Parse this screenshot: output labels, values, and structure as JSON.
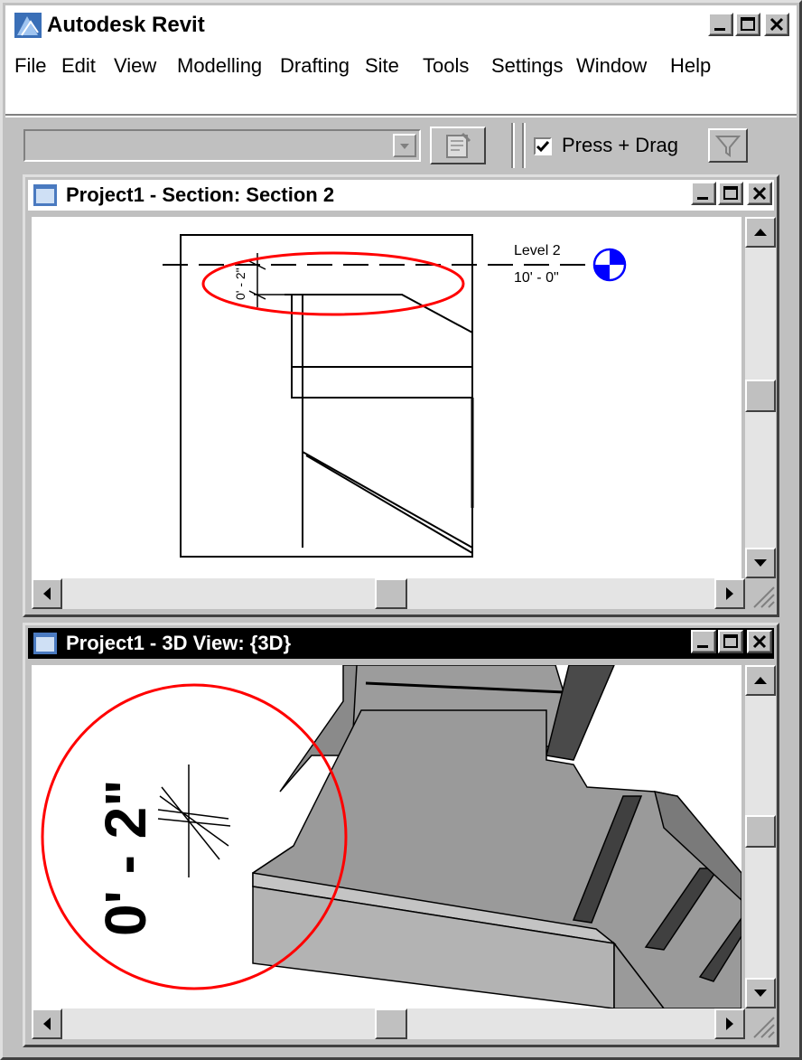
{
  "app": {
    "title": "Autodesk Revit"
  },
  "menu": [
    "File",
    "Edit",
    "View",
    "Modelling",
    "Drafting",
    "Site",
    "Tools",
    "Settings",
    "Window",
    "Help"
  ],
  "toolbar": {
    "type_selector_value": "",
    "press_drag_label": "Press + Drag",
    "press_drag_checked": true
  },
  "section_view": {
    "title": "Project1 - Section: Section 2",
    "level_name": "Level 2",
    "level_elevation": "10' - 0\"",
    "dimension": "0' - 2\""
  },
  "view3d": {
    "title": "Project1 - 3D View: {3D}",
    "dimension": "0' - 2\""
  },
  "colors": {
    "active_title": "#000000",
    "inactive_title": "#ffffff",
    "highlight": "#ff0000",
    "level_marker": "#0000ff"
  }
}
